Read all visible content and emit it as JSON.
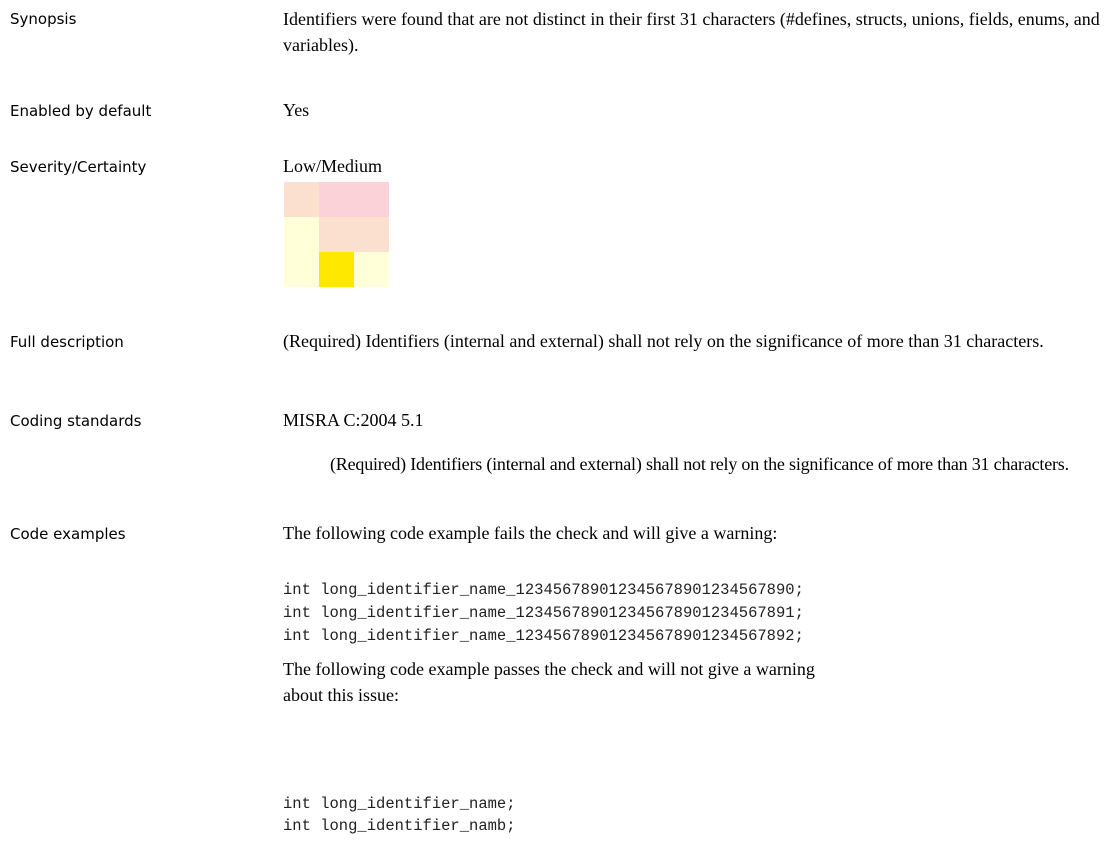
{
  "sections": {
    "synopsis": {
      "label": "Synopsis",
      "text": "Identifiers were found that are not distinct in their first 31 characters (#defines, structs, unions, fields, enums, and variables)."
    },
    "enabled": {
      "label": "Enabled by default",
      "value": "Yes"
    },
    "severity": {
      "label": "Severity/Certainty",
      "value": "Low/Medium",
      "matrix_colors": [
        [
          "#fbe0cf",
          "#fbd2d8",
          "#fbd2d8"
        ],
        [
          "#ffffd8",
          "#fbe0cf",
          "#fbe0cf"
        ],
        [
          "#ffffd8",
          "#ffe800",
          "#ffffd8"
        ]
      ]
    },
    "full_description": {
      "label": "Full description",
      "text": "(Required) Identifiers (internal and external) shall not rely on the significance of more than 31 characters."
    },
    "coding_standards": {
      "label": "Coding standards",
      "standard": "MISRA C:2004 5.1",
      "rule_text": "(Required) Identifiers (internal and external) shall not rely on the significance of more than 31 characters."
    },
    "code_examples": {
      "label": "Code examples",
      "fail_intro": "The following code example fails the check and will give a warning:",
      "fail_code": [
        "int long_identifier_name_12345678901234567890123456789​0;",
        "int long_identifier_name_123456789012345678901234567891;",
        "int long_identifier_name_123456789012345678901234567892;"
      ],
      "pass_intro": "The following code example passes the check and will not give a warning about this issue:",
      "pass_code": [
        "int long_identifier_name;",
        "int long_identifier_namb;"
      ]
    }
  }
}
